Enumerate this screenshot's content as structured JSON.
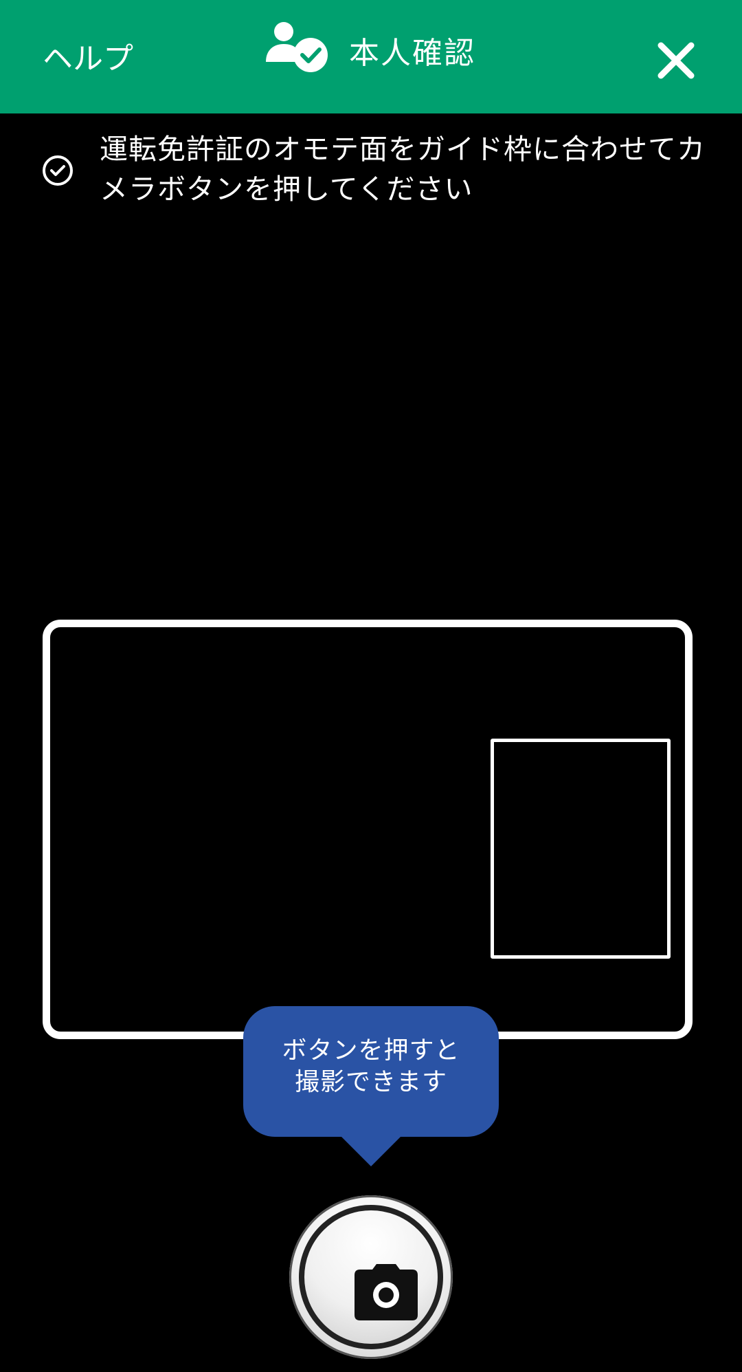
{
  "header": {
    "help_label": "ヘルプ",
    "title": "本人確認",
    "title_icon": "person-check-icon",
    "close_icon": "close-icon",
    "background_color": "#00a06f"
  },
  "instruction": {
    "icon": "check-circle-icon",
    "line1": "運転免許証のオモテ面をガイド枠に合わせてカ",
    "line2": "メラボタンを押してください"
  },
  "tooltip": {
    "line1": "ボタンを押すと",
    "line2": "撮影できます",
    "background_color": "#2a53a5"
  },
  "shutter": {
    "icon": "camera-icon"
  }
}
